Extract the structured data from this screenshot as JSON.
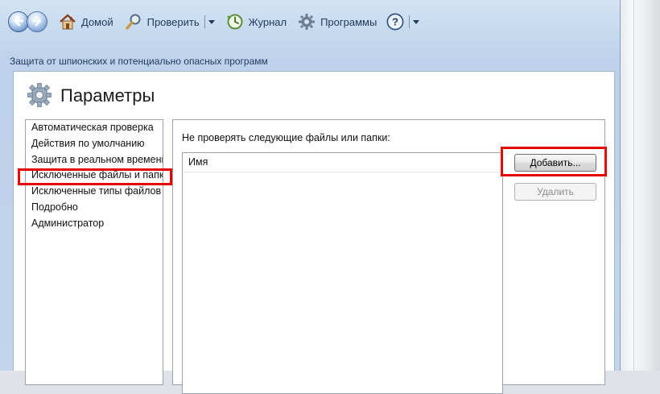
{
  "toolbar": {
    "home_label": "Домой",
    "scan_label": "Проверить",
    "history_label": "Журнал",
    "tools_label": "Программы"
  },
  "subtitle": "Защита от шпионских  и потенциально опасных программ",
  "panel": {
    "title": "Параметры",
    "sidebar_items": [
      {
        "label": "Автоматическая проверка"
      },
      {
        "label": "Действия по умолчанию"
      },
      {
        "label": "Защита в реальном времени"
      },
      {
        "label": "Исключенные файлы и папки"
      },
      {
        "label": "Исключенные типы файлов"
      },
      {
        "label": "Подробно"
      },
      {
        "label": "Администратор"
      }
    ],
    "exclude_label": "Не проверять следующие файлы или папки:",
    "column_name": "Имя",
    "add_button": "Добавить...",
    "remove_button": "Удалить"
  },
  "colors": {
    "highlight": "#e60000",
    "frame_blue": "#c6daef",
    "accent_text": "#1e395b"
  },
  "icons": [
    "back-arrow-icon",
    "forward-arrow-icon",
    "home-icon",
    "search-icon",
    "history-icon",
    "gear-icon",
    "help-icon",
    "dropdown-arrow-icon",
    "settings-gear-icon"
  ]
}
